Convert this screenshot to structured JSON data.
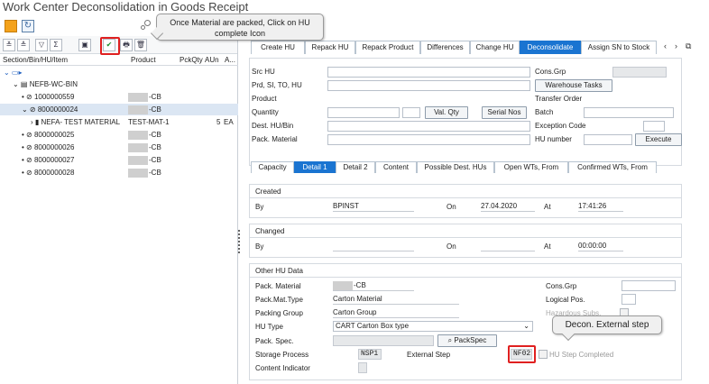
{
  "window_title": "Work Center Deconsolidation in Goods Receipt",
  "toolbar": {
    "exit_glyph": "↻"
  },
  "tree": {
    "headers": {
      "col_node": "Section/Bin/HU/Item",
      "col_product": "Product",
      "col_pckqty": "PckQty",
      "col_aun": "AUn",
      "col_a": "A..."
    },
    "toolbar_glyphs": {
      "expand": "≚",
      "collapse": "≙",
      "filter": "▽",
      "sum": "Σ",
      "pack": "▣",
      "hu_complete": "✔",
      "print": "🖶",
      "delete": "🗑"
    },
    "bin": "NEFB-WC-BIN",
    "rows": [
      {
        "label": "1000000559",
        "product_suffix": "-CB"
      },
      {
        "label": "8000000024",
        "product_suffix": "-CB",
        "selected": true
      },
      {
        "label": "NEFA- TEST MATERIAL",
        "product": "TEST-MAT-1",
        "qty": "5",
        "unit": "EA"
      },
      {
        "label": "8000000025",
        "product_suffix": "-CB"
      },
      {
        "label": "8000000026",
        "product_suffix": "-CB"
      },
      {
        "label": "8000000027",
        "product_suffix": "-CB"
      },
      {
        "label": "8000000028",
        "product_suffix": "-CB"
      }
    ]
  },
  "callouts": {
    "pack_hint": "Once Material are packed, Click on HU complete Icon",
    "decon_hint": "Decon. External step"
  },
  "main_tabs": [
    "Create HU",
    "Repack HU",
    "Repack Product",
    "Differences",
    "Change HU",
    "Deconsolidate",
    "Assign SN to Stock"
  ],
  "main_tab_active": "Deconsolidate",
  "nav": {
    "prev": "‹",
    "next": "›",
    "menu": "⧉"
  },
  "form": {
    "src_hu": "Src HU",
    "prd_si": "Prd, SI, TO, HU",
    "product": "Product",
    "quantity": "Quantity",
    "dest_hu_bin": "Dest. HU/Bin",
    "pack_material": "Pack. Material",
    "cons_grp": "Cons.Grp",
    "warehouse_tasks_btn": "Warehouse Tasks",
    "transfer_order": "Transfer Order",
    "val_qty_btn": "Val. Qty",
    "serial_nos_btn": "Serial Nos",
    "batch": "Batch",
    "exception_code": "Exception Code",
    "hu_number": "HU number",
    "execute_btn": "Execute"
  },
  "detail_tabs": [
    "Capacity",
    "Detail 1",
    "Detail 2",
    "Content",
    "Possible Dest. HUs",
    "Open WTs, From",
    "Confirmed WTs, From"
  ],
  "detail_tab_active": "Detail 1",
  "created": {
    "title": "Created",
    "by_label": "By",
    "by_value": "BPINST",
    "on_label": "On",
    "on_value": "27.04.2020",
    "at_label": "At",
    "at_value": "17:41:26"
  },
  "changed": {
    "title": "Changed",
    "by_label": "By",
    "by_value": "",
    "on_label": "On",
    "on_value": "",
    "at_label": "At",
    "at_value": "00:00:00"
  },
  "other": {
    "title": "Other HU Data",
    "pack_material_label": "Pack. Material",
    "pack_material_suffix": "-CB",
    "packmat_type_label": "Pack.Mat.Type",
    "packmat_type_value": "Carton Material",
    "packing_group_label": "Packing Group",
    "packing_group_value": "Carton Group",
    "hu_type_label": "HU Type",
    "hu_type_value": "CART Carton Box type",
    "pack_spec_label": "Pack. Spec.",
    "packspec_btn": "PackSpec",
    "storage_process_label": "Storage Process",
    "storage_process_value": "NSP1",
    "external_step_label": "External Step",
    "external_step_value": "NF02",
    "hu_step_completed_label": "HU Step Completed",
    "content_indicator_label": "Content Indicator",
    "cons_grp_label": "Cons.Grp",
    "logical_pos_label": "Logical Pos.",
    "hazardous_label": "Hazardous Subs."
  }
}
